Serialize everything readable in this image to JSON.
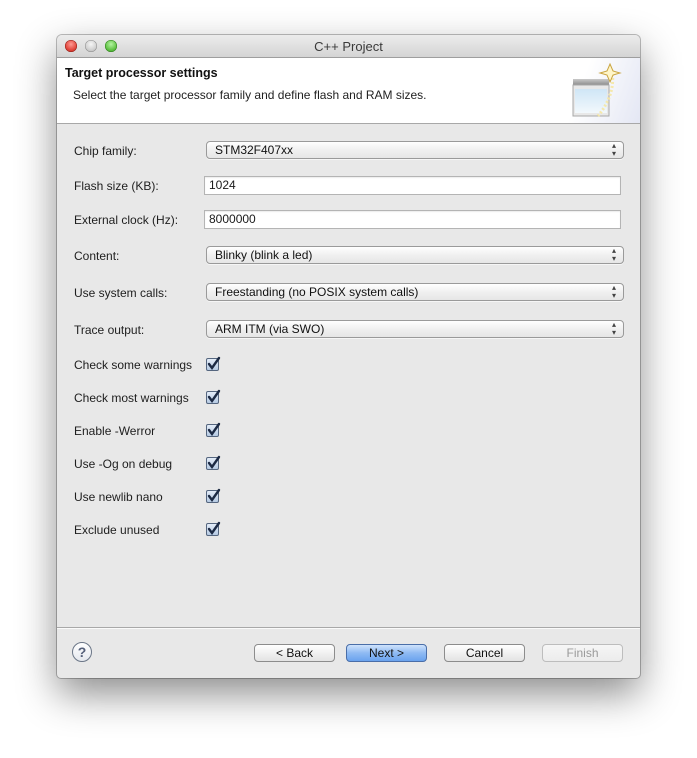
{
  "window": {
    "title": "C++ Project"
  },
  "header": {
    "title": "Target processor settings",
    "description": "Select the target processor family and define flash and RAM sizes.",
    "icon": "wizard-window-icon"
  },
  "form": {
    "chip_family": {
      "label": "Chip family:",
      "value": "STM32F407xx"
    },
    "flash_size": {
      "label": "Flash size (KB):",
      "value": "1024"
    },
    "external_clock": {
      "label": "External clock (Hz):",
      "value": "8000000"
    },
    "content": {
      "label": "Content:",
      "value": "Blinky (blink a led)"
    },
    "system_calls": {
      "label": "Use system calls:",
      "value": "Freestanding (no POSIX system calls)"
    },
    "trace_output": {
      "label": "Trace output:",
      "value": "ARM ITM (via SWO)"
    },
    "checkboxes": [
      {
        "label": "Check some warnings",
        "checked": true
      },
      {
        "label": "Check most warnings",
        "checked": true
      },
      {
        "label": "Enable -Werror",
        "checked": true
      },
      {
        "label": "Use -Og on debug",
        "checked": true
      },
      {
        "label": "Use newlib nano",
        "checked": true
      },
      {
        "label": "Exclude unused",
        "checked": true
      }
    ]
  },
  "footer": {
    "help_glyph": "?",
    "back_label": "< Back",
    "next_label": "Next >",
    "cancel_label": "Cancel",
    "finish_label": "Finish"
  },
  "icons": {
    "select_arrows": "▲▼",
    "check": "check-icon"
  }
}
